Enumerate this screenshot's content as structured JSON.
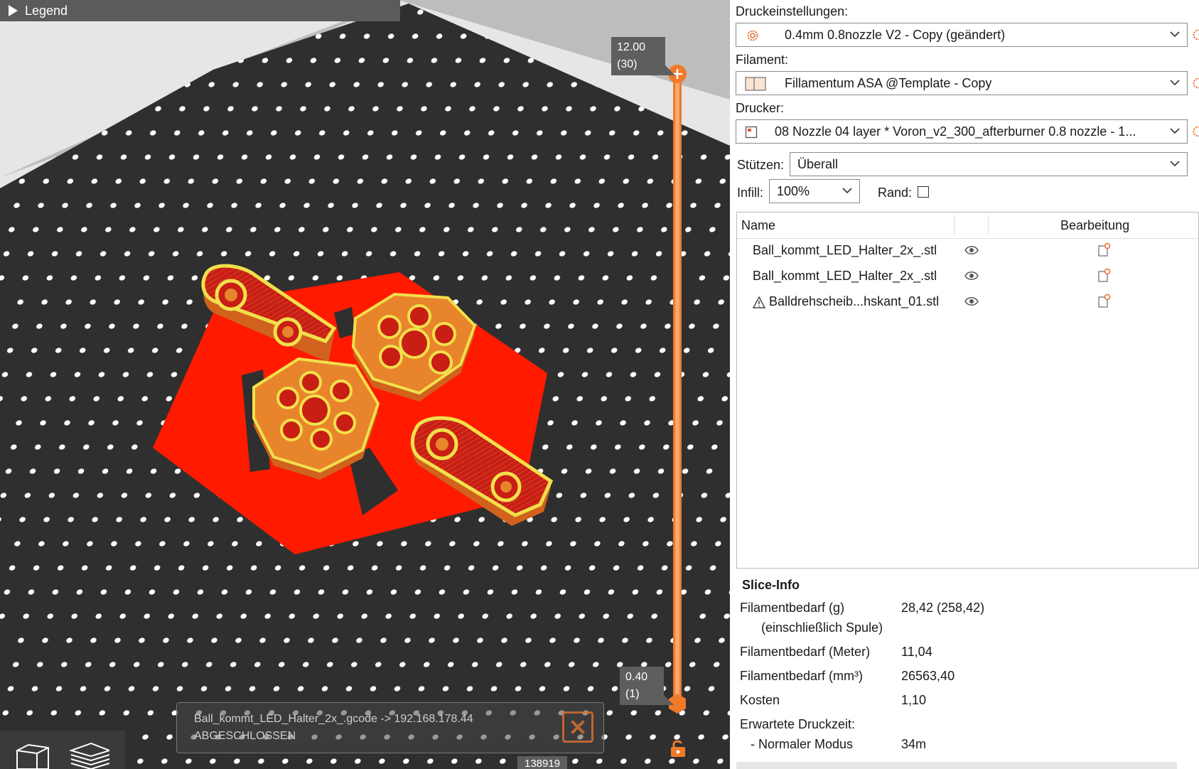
{
  "viewport": {
    "legend_label": "Legend",
    "layer_top": {
      "height": "12.00",
      "layer": "(30)"
    },
    "layer_bottom": {
      "height": "0.40",
      "layer": "(1)"
    },
    "job": {
      "line1": "Ball_kommt_LED_Halter_2x_.gcode -> 192.168.178.44",
      "line2": "ABGESCHLOSSEN"
    },
    "moves_count": "138919",
    "colors": {
      "bed": "#2f2f2f",
      "dots": "#ffffff",
      "brim": "#ff1a00",
      "part": "#e8842c",
      "infill": "#c81e14",
      "perimeter": "#f1e04a",
      "slider": "#f07a2a"
    }
  },
  "panel": {
    "print_settings": {
      "label": "Druckeinstellungen:",
      "value": "0.4mm 0.8nozzle V2 - Copy (geändert)"
    },
    "filament": {
      "label": "Filament:",
      "value": "Fillamentum ASA @Template - Copy"
    },
    "printer": {
      "label": "Drucker:",
      "value": "08 Nozzle 04 layer * Voron_v2_300_afterburner 0.8 nozzle - 1..."
    },
    "supports": {
      "label": "Stützen:",
      "value": "Überall"
    },
    "infill": {
      "label": "Infill:",
      "value": "100%"
    },
    "brim": {
      "label": "Rand:",
      "checked": false
    },
    "object_list": {
      "headers": {
        "name": "Name",
        "edit": "Bearbeitung"
      },
      "rows": [
        {
          "name": "Ball_kommt_LED_Halter_2x_.stl",
          "warning": false
        },
        {
          "name": "Ball_kommt_LED_Halter_2x_.stl",
          "warning": false
        },
        {
          "name": "Balldrehscheib...hskant_01.stl",
          "warning": true
        }
      ]
    },
    "slice_info": {
      "title": "Slice-Info",
      "filament_g_label": "Filamentbedarf (g)",
      "filament_g_sub": "(einschließlich Spule)",
      "filament_g_value": "28,42 (258,42)",
      "filament_m_label": "Filamentbedarf (Meter)",
      "filament_m_value": "11,04",
      "filament_mm3_label": "Filamentbedarf (mm³)",
      "filament_mm3_value": "26563,40",
      "cost_label": "Kosten",
      "cost_value": "1,10",
      "time_label": "Erwartete Druckzeit:",
      "mode_label": "- Normaler Modus",
      "mode_value": "34m"
    }
  }
}
